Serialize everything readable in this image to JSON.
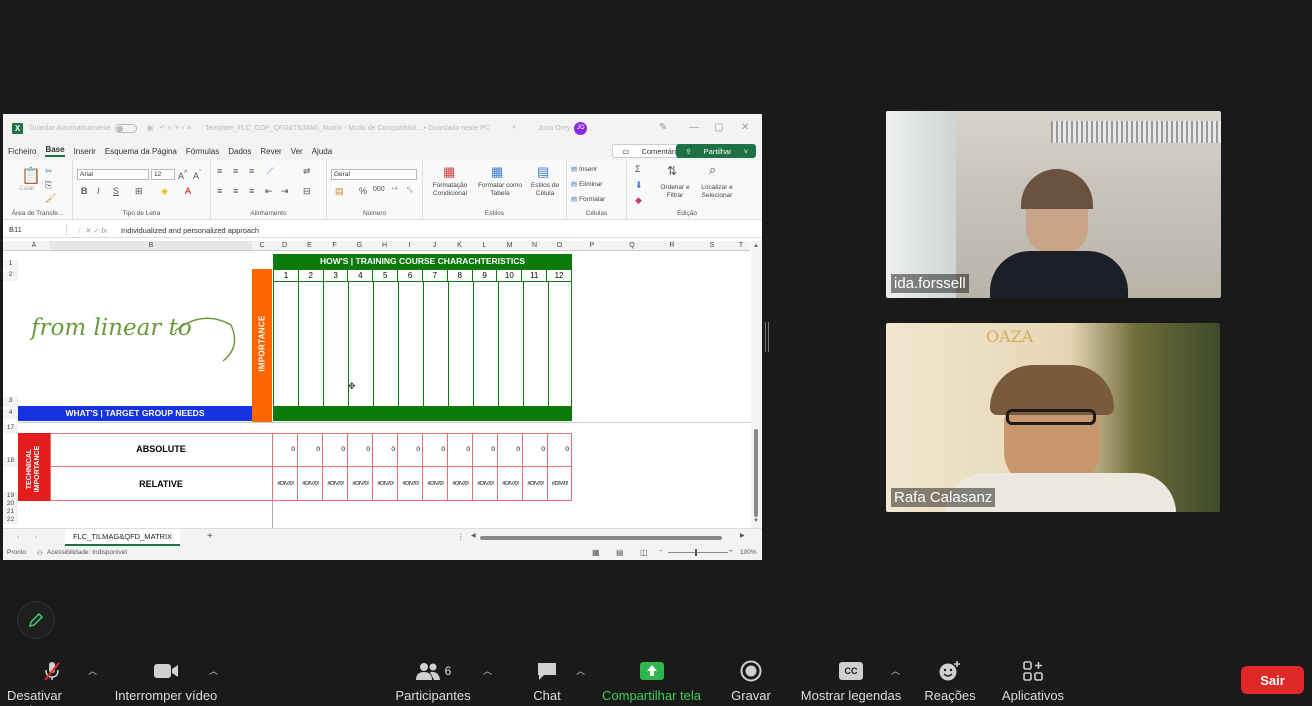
{
  "excel": {
    "autosave_label": "Guardar Automaticamente",
    "doc_title": "Template_FLC_COP_QFD&TILMAG_Matrix  -  Modo de Compatibilid...  •  Guardado neste PC",
    "user_name": "Joao Orey",
    "user_initials": "JO",
    "menu": [
      "Ficheiro",
      "Base",
      "Inserir",
      "Esquema da Página",
      "Fórmulas",
      "Dados",
      "Rever",
      "Ver",
      "Ajuda"
    ],
    "active_menu": "Base",
    "comments_label": "Comentários",
    "share_label": "Partilhar",
    "ribbon": {
      "paste": "Colar",
      "clipboard_group": "Área de Transfe...",
      "font_name": "Arial",
      "font_size": "12",
      "font_group": "Tipo de Letra",
      "align_group": "Alinhamento",
      "number_format": "Geral",
      "number_group": "Número",
      "cond_format": "Formatação Condicional",
      "format_table": "Formatar como Tabela",
      "cell_styles": "Estilos de Célula",
      "styles_group": "Estilos",
      "insert": "Inserir",
      "delete": "Eliminar",
      "format": "Formatar",
      "cells_group": "Células",
      "sort_filter": "Ordenar e Filtrar",
      "find_select": "Localizar e Selecionar",
      "edit_group": "Edição"
    },
    "name_box": "B11",
    "formula": "Individualized and personalized approach",
    "columns": [
      "A",
      "B",
      "C",
      "D",
      "E",
      "F",
      "G",
      "H",
      "I",
      "J",
      "K",
      "L",
      "M",
      "N",
      "O",
      "P",
      "Q",
      "R",
      "S",
      "T"
    ],
    "rows": [
      "1",
      "2",
      "3",
      "4",
      "17",
      "18",
      "19",
      "20",
      "21",
      "22"
    ],
    "hows_header": "HOW'S | TRAINING COURSE CHARACHTERISTICS",
    "hows_numbers": [
      "1",
      "2",
      "3",
      "4",
      "5",
      "6",
      "7",
      "8",
      "9",
      "10",
      "11",
      "12"
    ],
    "logo_text": "from linear to circular",
    "importance_label": "IMPORTANCE",
    "whats_label": "WHAT'S | TARGET GROUP NEEDS",
    "technical_importance": "TECHNICAL IMPORTANCE",
    "absolute_label": "ABSOLUTE",
    "relative_label": "RELATIVE",
    "absolute_values": [
      "0",
      "0",
      "0",
      "0",
      "0",
      "0",
      "0",
      "0",
      "0",
      "0",
      "0",
      "0"
    ],
    "relative_values": [
      "#DIV/0!",
      "#DIV/0!",
      "#DIV/0!",
      "#DIV/0!",
      "#DIV/0!",
      "#DIV/0!",
      "#DIV/0!",
      "#DIV/0!",
      "#DIV/0!",
      "#DIV/0!",
      "#DIV/0!",
      "#DIV/0!"
    ],
    "sheet_tab": "FLC_TILMAG&QFD_MATRIX",
    "status_ready": "Pronto",
    "status_accessibility": "Acessibilidade: Indisponível",
    "zoom": "100%",
    "colors": {
      "green": "#0a7a0a",
      "blue": "#1533e0",
      "orange": "#ff6600",
      "red": "#e31c1c"
    }
  },
  "participants": [
    {
      "name": "ida.forssell"
    },
    {
      "name": "Rafa Calasanz"
    }
  ],
  "toolbar": {
    "mute": "Desativar mudo",
    "video": "Interromper vídeo",
    "participants": "Participantes",
    "participants_count": "6",
    "chat": "Chat",
    "share": "Compartilhar tela",
    "record": "Gravar",
    "captions": "Mostrar legendas",
    "reactions": "Reações",
    "apps": "Aplicativos",
    "leave": "Sair",
    "cc_badge": "CC"
  }
}
